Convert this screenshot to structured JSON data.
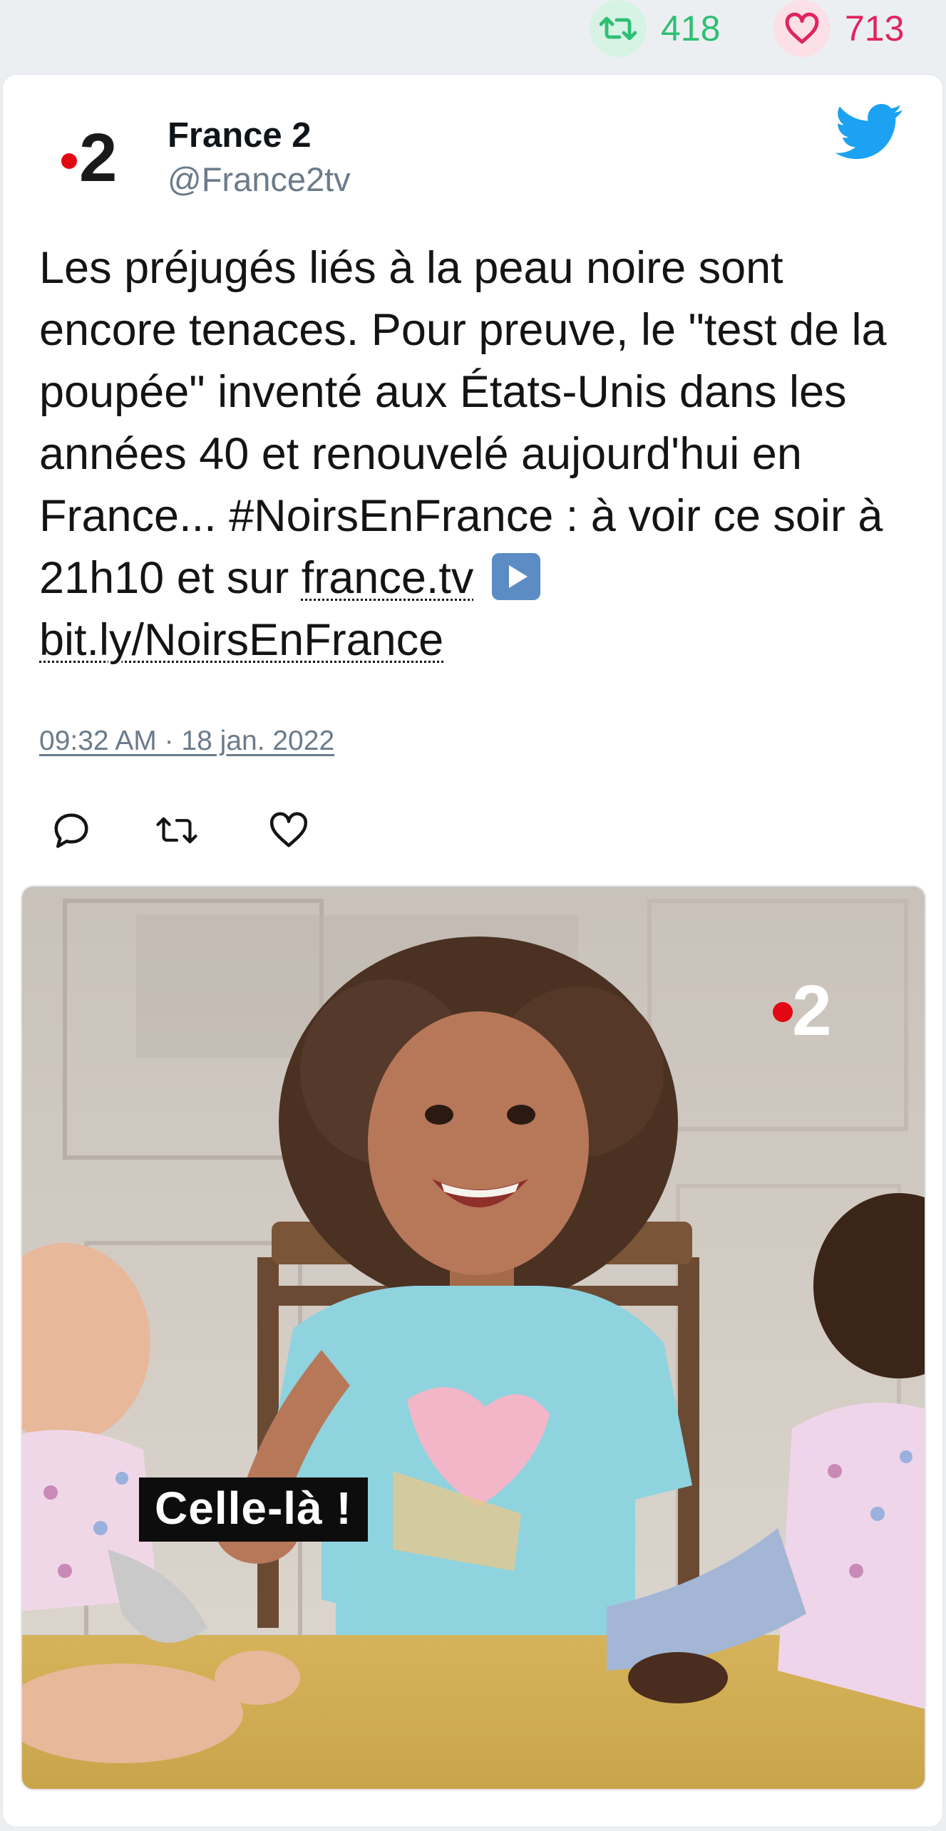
{
  "stats": {
    "retweets": "418",
    "likes": "713",
    "retweet_color": "#2ebf74",
    "like_color": "#e0245e"
  },
  "author": {
    "name": "France 2",
    "handle": "@France2tv",
    "logo": "france2-logo",
    "logo_text": "2"
  },
  "tweet": {
    "text_parts": [
      "Les préjugés liés à la peau noire sont encore tenaces. Pour preuve, le \"test de la poupée\" inventé aux États-Unis dans les années 40 et renouvelé aujourd'hui en France... #NoirsEnFrance : à voir ce soir à 21h10 et sur ",
      "france.tv",
      "bit.ly/NoirsEnFrance"
    ],
    "timestamp": "09:32 AM · 18 jan. 2022"
  },
  "actions": [
    "reply-icon",
    "retweet-icon",
    "like-icon"
  ],
  "media": {
    "caption": "Celle-là !",
    "watermark": "2"
  },
  "colors": {
    "twitter_blue": "#1da1f2",
    "france2_red": "#e30613"
  }
}
